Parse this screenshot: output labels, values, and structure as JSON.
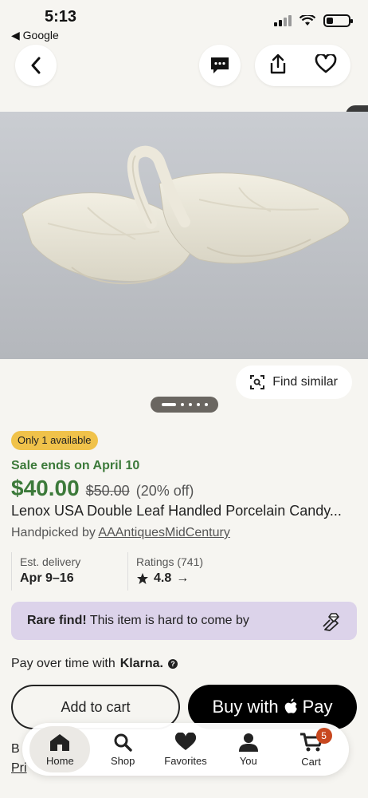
{
  "status": {
    "time": "5:13",
    "back_label": "◀ Google"
  },
  "actions": {
    "find_similar": "Find similar"
  },
  "listing": {
    "availability": "Only 1 available",
    "sale_ends": "Sale ends on April 10",
    "price": "$40.00",
    "original_price": "$50.00",
    "discount": "(20% off)",
    "title": "Lenox USA Double Leaf Handled Porcelain Candy...",
    "handpicked_prefix": "Handpicked by ",
    "shop_name": "AAAntiquesMidCentury",
    "delivery_label": "Est. delivery",
    "delivery_value": "Apr 9–16",
    "ratings_label": "Ratings (741)",
    "rating_value": "4.8",
    "rating_arrow": "→",
    "rare_bold": "Rare find!",
    "rare_text": " This item is hard to come by",
    "klarna_text": "Pay over time with",
    "klarna_brand": "Klarna.",
    "add_to_cart": "Add to cart",
    "buy_with": "Buy with",
    "pay": "Pay",
    "below_1": "B",
    "below_2": "Pri"
  },
  "tabs": [
    {
      "label": "Home",
      "icon": "home-icon"
    },
    {
      "label": "Shop",
      "icon": "search-icon"
    },
    {
      "label": "Favorites",
      "icon": "heart-icon"
    },
    {
      "label": "You",
      "icon": "person-icon"
    },
    {
      "label": "Cart",
      "icon": "cart-icon",
      "badge": "5"
    }
  ],
  "carousel": {
    "current": 1,
    "total": 5
  },
  "colors": {
    "sale_green": "#3c7a3a",
    "badge_yellow": "#f0c24a",
    "rare_purple": "#dcd3ea",
    "cart_badge": "#c8481f"
  }
}
